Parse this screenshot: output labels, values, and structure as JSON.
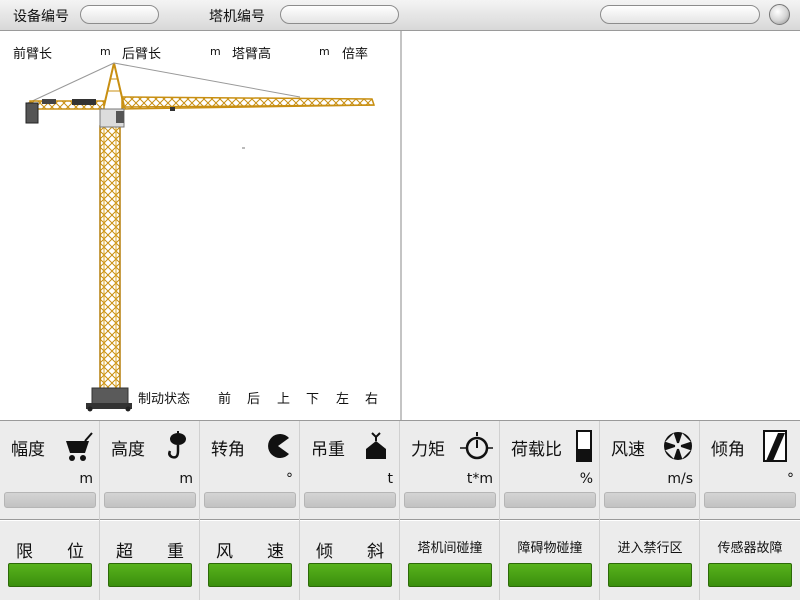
{
  "header": {
    "device_label": "设备编号",
    "device_value": "",
    "crane_label": "塔机编号",
    "crane_value": "",
    "right_value": ""
  },
  "info": {
    "front_arm_label": "前臂长",
    "front_arm_unit": "m",
    "rear_arm_label": "后臂长",
    "rear_arm_unit": "m",
    "tower_height_label": "塔臂高",
    "tower_height_unit": "m",
    "ratio_label": "倍率"
  },
  "brake": {
    "label": "制动状态",
    "dirs": [
      "前",
      "后",
      "上",
      "下",
      "左",
      "右"
    ]
  },
  "sensors": [
    {
      "label": "幅度",
      "icon": "trolley-icon",
      "unit": "m"
    },
    {
      "label": "高度",
      "icon": "hook-icon",
      "unit": "m"
    },
    {
      "label": "转角",
      "icon": "rotation-angle-icon",
      "unit": "°"
    },
    {
      "label": "吊重",
      "icon": "load-weight-icon",
      "unit": "t"
    },
    {
      "label": "力矩",
      "icon": "torque-icon",
      "unit": "t*m"
    },
    {
      "label": "荷载比",
      "icon": "load-ratio-icon",
      "unit": "%"
    },
    {
      "label": "风速",
      "icon": "wind-fan-icon",
      "unit": "m/s"
    },
    {
      "label": "倾角",
      "icon": "tilt-icon",
      "unit": "°"
    }
  ],
  "alarms": [
    {
      "label": "限　　位",
      "big": true
    },
    {
      "label": "超　　重",
      "big": true
    },
    {
      "label": "风　　速",
      "big": true
    },
    {
      "label": "倾　　斜",
      "big": true
    },
    {
      "label": "塔机间碰撞",
      "big": false
    },
    {
      "label": "障碍物碰撞",
      "big": false
    },
    {
      "label": "进入禁行区",
      "big": false
    },
    {
      "label": "传感器故障",
      "big": false
    }
  ],
  "colors": {
    "crane_yellow": "#d9a21e",
    "alarm_green": "#4aa114",
    "panel_gray": "#ececec"
  }
}
